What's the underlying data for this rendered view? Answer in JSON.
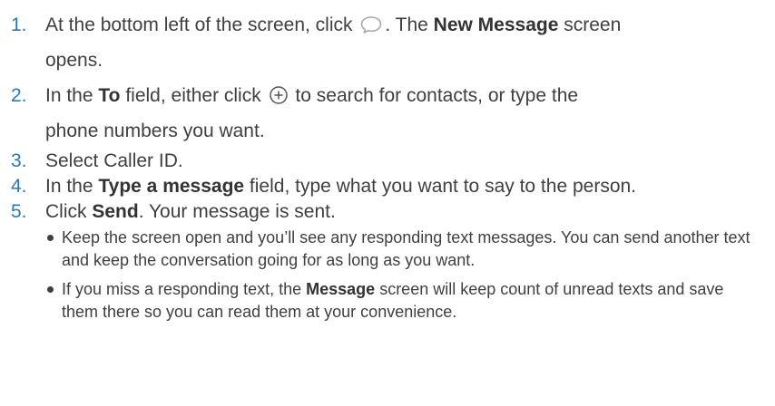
{
  "steps": [
    {
      "number": "1.",
      "before_icon": "At the bottom left of the screen, click",
      "icon": "chat-bubble-icon",
      "after_icon": ". The ",
      "bold": "New Message",
      "after_bold": " screen",
      "continuation": "opens."
    },
    {
      "number": "2.",
      "before_bold": "In the ",
      "bold": "To",
      "after_bold": " field, either click",
      "icon": "plus-circle-icon",
      "after_icon": " to search for contacts, or type the",
      "continuation": "phone numbers you want."
    },
    {
      "number": "3.",
      "text": "Select Caller ID."
    },
    {
      "number": "4.",
      "before_bold": "In the ",
      "bold": "Type a message",
      "after_bold": " field, type what you want to say to the person."
    },
    {
      "number": "5.",
      "before_bold": "Click ",
      "bold": "Send",
      "after_bold": ". Your message is sent.",
      "bullets": [
        {
          "text": "Keep the screen open and you’ll see any responding text messages. You can send another text and keep the conversation going for as long as you want."
        },
        {
          "before_bold": "If you miss a responding text, the ",
          "bold": "Message",
          "after_bold": " screen will keep count of unread texts and save them there so you can read them at your convenience."
        }
      ]
    }
  ]
}
